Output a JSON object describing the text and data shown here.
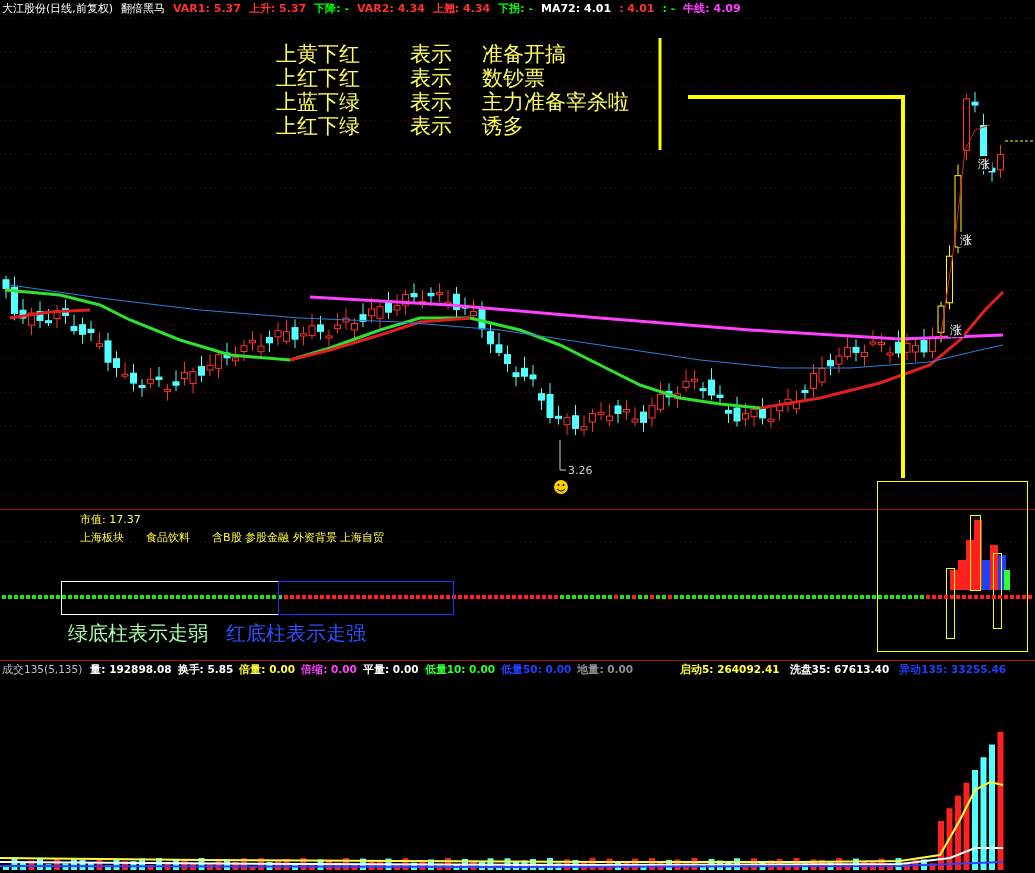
{
  "chart_title": "大江股份(日线,前复权)",
  "indicator_name": "翻倍黑马",
  "indicators": [
    {
      "text": "VAR1: 5.37",
      "color": "#ff3030"
    },
    {
      "text": "上升: 5.37",
      "color": "#ff3030"
    },
    {
      "text": "下降: -",
      "color": "#00ff00"
    },
    {
      "text": "VAR2: 4.34",
      "color": "#ff3030"
    },
    {
      "text": "上翘: 4.34",
      "color": "#ff3030"
    },
    {
      "text": "下拐: -",
      "color": "#00ff00"
    },
    {
      "text": "MA72: 4.01",
      "color": "#ffffff"
    },
    {
      "text": ": 4.01",
      "color": "#ff3030"
    },
    {
      "text": ": -",
      "color": "#00ff00"
    },
    {
      "text": "牛线: 4.09",
      "color": "#ff40ff"
    }
  ],
  "legend": [
    {
      "bars": "上黄下红",
      "verb": "表示",
      "meaning": "准备开搞"
    },
    {
      "bars": "上红下红",
      "verb": "表示",
      "meaning": "数钞票"
    },
    {
      "bars": "上蓝下绿",
      "verb": "表示",
      "meaning": "主力准备宰杀啦"
    },
    {
      "bars": "上红下绿",
      "verb": "表示",
      "meaning": "诱多"
    }
  ],
  "low_price_label": "3.26",
  "rise_marks": [
    "涨",
    "涨",
    "涨"
  ],
  "market_value": "市值: 17.37",
  "sectors": [
    "上海板块",
    "食品饮料",
    "含B股 参股金融 外资背景 上海自贸"
  ],
  "hints": [
    {
      "text": "绿底柱表示走弱",
      "color": "#a8ffa8"
    },
    {
      "text": "红底柱表示走强",
      "color": "#3050ff"
    }
  ],
  "volume_panel": {
    "title": "成交135(5,135)",
    "stats": [
      {
        "text": "量: 192898.08",
        "color": "#ffffff"
      },
      {
        "text": "换手: 5.85",
        "color": "#ffffff"
      },
      {
        "text": "倍量: 0.00",
        "color": "#ffff40"
      },
      {
        "text": "倍缩: 0.00",
        "color": "#ff40ff"
      },
      {
        "text": "平量: 0.00",
        "color": "#ffffff"
      },
      {
        "text": "低量10: 0.00",
        "color": "#30ff30"
      },
      {
        "text": "低量50: 0.00",
        "color": "#2040ff"
      },
      {
        "text": "地量: 0.00",
        "color": "#909090"
      },
      {
        "text": "启动5: 264092.41",
        "color": "#ffff40"
      },
      {
        "text": "洗盘35: 67613.40",
        "color": "#ffffff"
      },
      {
        "text": "异动135: 33255.46",
        "color": "#2040ff"
      }
    ]
  }
}
